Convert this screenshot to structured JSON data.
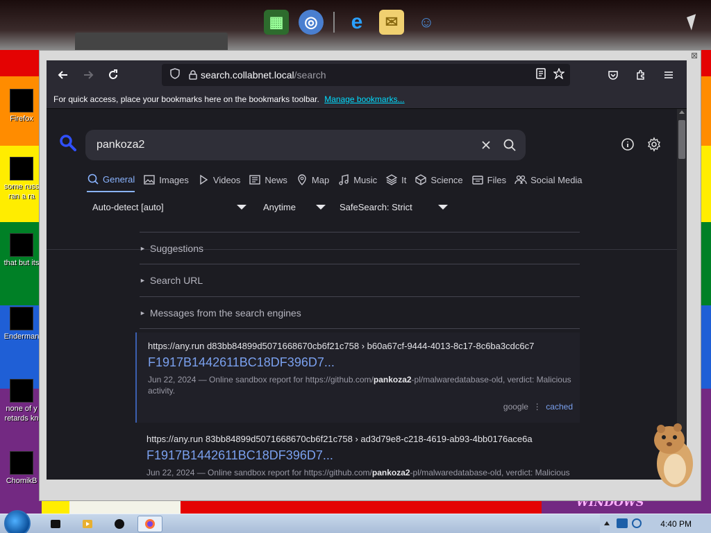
{
  "browser": {
    "url_host": "search.collabnet.local",
    "url_path": "/search",
    "bookmarks_bar": {
      "message": "For quick access, place your bookmarks here on the bookmarks toolbar.",
      "link": "Manage bookmarks..."
    }
  },
  "search": {
    "query": "pankoza2",
    "categories": [
      {
        "label": "General",
        "icon": "search-icon",
        "active": true
      },
      {
        "label": "Images",
        "icon": "image-icon"
      },
      {
        "label": "Videos",
        "icon": "play-icon"
      },
      {
        "label": "News",
        "icon": "newspaper-icon"
      },
      {
        "label": "Map",
        "icon": "map-pin-icon"
      },
      {
        "label": "Music",
        "icon": "music-note-icon"
      },
      {
        "label": "It",
        "icon": "layers-icon"
      },
      {
        "label": "Science",
        "icon": "cube-icon"
      },
      {
        "label": "Files",
        "icon": "files-icon"
      },
      {
        "label": "Social Media",
        "icon": "people-icon"
      }
    ],
    "filters": {
      "language": "Auto-detect [auto]",
      "time": "Anytime",
      "safesearch": "SafeSearch: Strict"
    },
    "collapsibles": [
      "Suggestions",
      "Search URL",
      "Messages from the search engines"
    ],
    "results": [
      {
        "url": "https://any.run  d83bb84899d5071668670cb6f21c758 › b60a67cf-9444-4013-8c17-8c6ba3cdc6c7",
        "title": "F1917B1442611BC18DF396D7...",
        "desc_pre": "Jun 22, 2024 — Online sandbox report for https://github.com/",
        "desc_bold": "pankoza2",
        "desc_post": "-pl/malwaredatabase-old, verdict: Malicious activity.",
        "engine": "google",
        "cached": "cached"
      },
      {
        "url": "https://any.run  83bb84899d5071668670cb6f21c758 › ad3d79e8-c218-4619-ab93-4bb0176ace6a",
        "title": "F1917B1442611BC18DF396D7...",
        "desc_pre": "Jun 22, 2024 — Online sandbox report for https://github.com/",
        "desc_bold": "pankoza2",
        "desc_post": "-pl/malwaredatabase-old, verdict: Malicious activity."
      }
    ]
  },
  "desktop": {
    "icons": [
      {
        "label": "Firefox"
      },
      {
        "label": "some russ ran a ra"
      },
      {
        "label": "that but its"
      },
      {
        "label": "Enderman"
      },
      {
        "label": "none of y retards kn"
      },
      {
        "label": "ChomikB"
      }
    ],
    "watermark": "WINDOWS"
  },
  "taskbar": {
    "clock": "4:40 PM"
  }
}
